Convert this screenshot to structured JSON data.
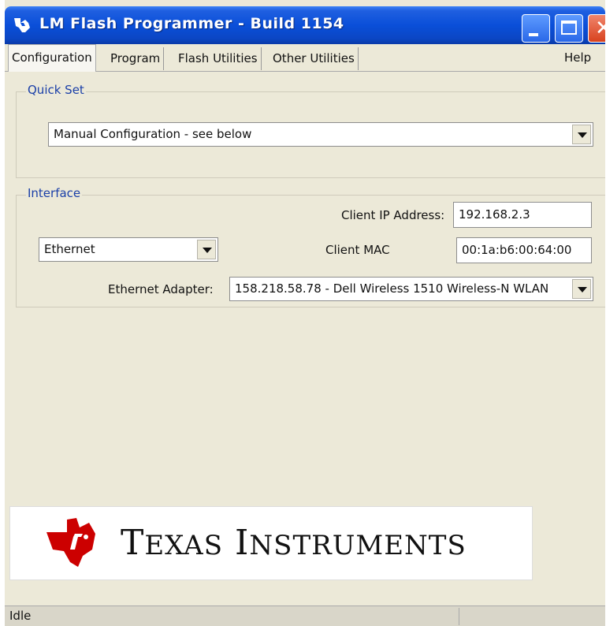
{
  "window": {
    "title": "LM Flash Programmer - Build 1154",
    "titlebar_color": "#0a4fd9"
  },
  "tabs": [
    {
      "label": "Configuration",
      "active": true
    },
    {
      "label": "Program",
      "active": false
    },
    {
      "label": "Flash Utilities",
      "active": false
    },
    {
      "label": "Other Utilities",
      "active": false
    }
  ],
  "menu": {
    "help_label": "Help"
  },
  "quick_set": {
    "label": "Quick Set",
    "selected": "Manual Configuration - see below"
  },
  "interface": {
    "label": "Interface",
    "type_selected": "Ethernet",
    "client_ip_label": "Client IP Address:",
    "client_ip_value": "192.168.2.3",
    "client_mac_label": "Client MAC",
    "client_mac_value": "00:1a:b6:00:64:00",
    "adapter_label": "Ethernet Adapter:",
    "adapter_selected": "158.218.58.78 - Dell Wireless 1510 Wireless-N WLAN"
  },
  "branding": {
    "logo_text": "Texas Instruments",
    "logo_color": "#cc0000"
  },
  "status": {
    "text": "Idle"
  }
}
